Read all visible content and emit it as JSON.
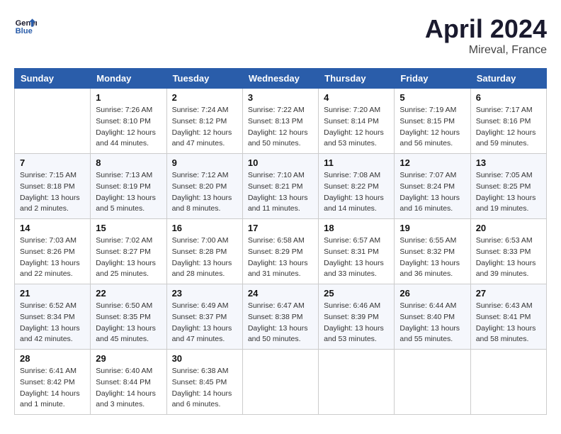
{
  "header": {
    "logo_line1": "General",
    "logo_line2": "Blue",
    "month": "April 2024",
    "location": "Mireval, France"
  },
  "columns": [
    "Sunday",
    "Monday",
    "Tuesday",
    "Wednesday",
    "Thursday",
    "Friday",
    "Saturday"
  ],
  "weeks": [
    [
      {
        "day": "",
        "empty": true
      },
      {
        "day": "1",
        "sunrise": "7:26 AM",
        "sunset": "8:10 PM",
        "daylight": "12 hours and 44 minutes."
      },
      {
        "day": "2",
        "sunrise": "7:24 AM",
        "sunset": "8:12 PM",
        "daylight": "12 hours and 47 minutes."
      },
      {
        "day": "3",
        "sunrise": "7:22 AM",
        "sunset": "8:13 PM",
        "daylight": "12 hours and 50 minutes."
      },
      {
        "day": "4",
        "sunrise": "7:20 AM",
        "sunset": "8:14 PM",
        "daylight": "12 hours and 53 minutes."
      },
      {
        "day": "5",
        "sunrise": "7:19 AM",
        "sunset": "8:15 PM",
        "daylight": "12 hours and 56 minutes."
      },
      {
        "day": "6",
        "sunrise": "7:17 AM",
        "sunset": "8:16 PM",
        "daylight": "12 hours and 59 minutes."
      }
    ],
    [
      {
        "day": "7",
        "sunrise": "7:15 AM",
        "sunset": "8:18 PM",
        "daylight": "13 hours and 2 minutes."
      },
      {
        "day": "8",
        "sunrise": "7:13 AM",
        "sunset": "8:19 PM",
        "daylight": "13 hours and 5 minutes."
      },
      {
        "day": "9",
        "sunrise": "7:12 AM",
        "sunset": "8:20 PM",
        "daylight": "13 hours and 8 minutes."
      },
      {
        "day": "10",
        "sunrise": "7:10 AM",
        "sunset": "8:21 PM",
        "daylight": "13 hours and 11 minutes."
      },
      {
        "day": "11",
        "sunrise": "7:08 AM",
        "sunset": "8:22 PM",
        "daylight": "13 hours and 14 minutes."
      },
      {
        "day": "12",
        "sunrise": "7:07 AM",
        "sunset": "8:24 PM",
        "daylight": "13 hours and 16 minutes."
      },
      {
        "day": "13",
        "sunrise": "7:05 AM",
        "sunset": "8:25 PM",
        "daylight": "13 hours and 19 minutes."
      }
    ],
    [
      {
        "day": "14",
        "sunrise": "7:03 AM",
        "sunset": "8:26 PM",
        "daylight": "13 hours and 22 minutes."
      },
      {
        "day": "15",
        "sunrise": "7:02 AM",
        "sunset": "8:27 PM",
        "daylight": "13 hours and 25 minutes."
      },
      {
        "day": "16",
        "sunrise": "7:00 AM",
        "sunset": "8:28 PM",
        "daylight": "13 hours and 28 minutes."
      },
      {
        "day": "17",
        "sunrise": "6:58 AM",
        "sunset": "8:29 PM",
        "daylight": "13 hours and 31 minutes."
      },
      {
        "day": "18",
        "sunrise": "6:57 AM",
        "sunset": "8:31 PM",
        "daylight": "13 hours and 33 minutes."
      },
      {
        "day": "19",
        "sunrise": "6:55 AM",
        "sunset": "8:32 PM",
        "daylight": "13 hours and 36 minutes."
      },
      {
        "day": "20",
        "sunrise": "6:53 AM",
        "sunset": "8:33 PM",
        "daylight": "13 hours and 39 minutes."
      }
    ],
    [
      {
        "day": "21",
        "sunrise": "6:52 AM",
        "sunset": "8:34 PM",
        "daylight": "13 hours and 42 minutes."
      },
      {
        "day": "22",
        "sunrise": "6:50 AM",
        "sunset": "8:35 PM",
        "daylight": "13 hours and 45 minutes."
      },
      {
        "day": "23",
        "sunrise": "6:49 AM",
        "sunset": "8:37 PM",
        "daylight": "13 hours and 47 minutes."
      },
      {
        "day": "24",
        "sunrise": "6:47 AM",
        "sunset": "8:38 PM",
        "daylight": "13 hours and 50 minutes."
      },
      {
        "day": "25",
        "sunrise": "6:46 AM",
        "sunset": "8:39 PM",
        "daylight": "13 hours and 53 minutes."
      },
      {
        "day": "26",
        "sunrise": "6:44 AM",
        "sunset": "8:40 PM",
        "daylight": "13 hours and 55 minutes."
      },
      {
        "day": "27",
        "sunrise": "6:43 AM",
        "sunset": "8:41 PM",
        "daylight": "13 hours and 58 minutes."
      }
    ],
    [
      {
        "day": "28",
        "sunrise": "6:41 AM",
        "sunset": "8:42 PM",
        "daylight": "14 hours and 1 minute."
      },
      {
        "day": "29",
        "sunrise": "6:40 AM",
        "sunset": "8:44 PM",
        "daylight": "14 hours and 3 minutes."
      },
      {
        "day": "30",
        "sunrise": "6:38 AM",
        "sunset": "8:45 PM",
        "daylight": "14 hours and 6 minutes."
      },
      {
        "day": "",
        "empty": true
      },
      {
        "day": "",
        "empty": true
      },
      {
        "day": "",
        "empty": true
      },
      {
        "day": "",
        "empty": true
      }
    ]
  ]
}
